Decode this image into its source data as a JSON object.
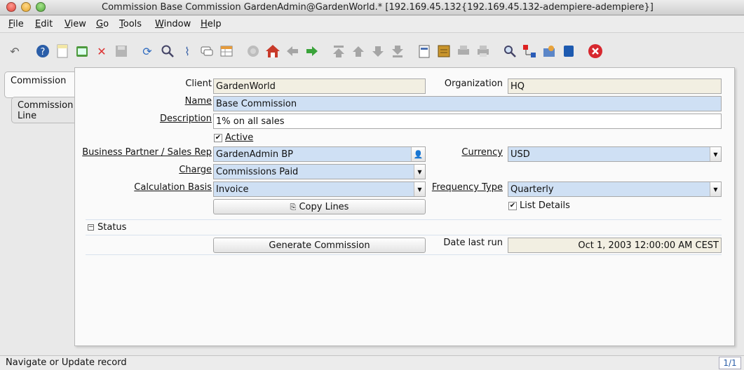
{
  "window": {
    "title": "Commission  Base Commission  GardenAdmin@GardenWorld.* [192.169.45.132{192.169.45.132-adempiere-adempiere}]"
  },
  "menu": [
    {
      "label": "File",
      "mnemonic": "F",
      "rest": "ile"
    },
    {
      "label": "Edit",
      "mnemonic": "E",
      "rest": "dit"
    },
    {
      "label": "View",
      "mnemonic": "V",
      "rest": "iew"
    },
    {
      "label": "Go",
      "mnemonic": "G",
      "rest": "o"
    },
    {
      "label": "Tools",
      "mnemonic": "T",
      "rest": "ools"
    },
    {
      "label": "Window",
      "mnemonic": "W",
      "rest": "indow"
    },
    {
      "label": "Help",
      "mnemonic": "H",
      "rest": "elp"
    }
  ],
  "toolbar": {
    "icons": [
      "undo-icon",
      "help-icon",
      "new-record-icon",
      "copy-record-icon",
      "delete-icon",
      "save-icon",
      "refresh-icon",
      "find-icon",
      "attachment-icon",
      "chat-icon",
      "grid-toggle-icon",
      "history-icon",
      "home-icon",
      "back-icon",
      "forward-icon",
      "first-record-icon",
      "previous-record-icon",
      "next-record-icon",
      "last-record-icon",
      "report-icon",
      "archive-icon",
      "print-preview-icon",
      "print-icon",
      "zoom-across-icon",
      "workflow-icon",
      "process-icon",
      "product-info-icon",
      "exit-icon"
    ]
  },
  "tabs": [
    {
      "label": "Commission"
    },
    {
      "label": "Commission Line"
    }
  ],
  "form": {
    "client_label": "Client",
    "client_value": "GardenWorld",
    "org_label": "Organization",
    "org_value": "HQ",
    "name_label": "Name",
    "name_value": "Base Commission",
    "description_label": "Description",
    "description_value": "1% on all sales",
    "active_label": "Active",
    "active_checked": true,
    "bpartner_label": "Business Partner / Sales Rep",
    "bpartner_value": "GardenAdmin BP",
    "currency_label": "Currency",
    "currency_value": "USD",
    "charge_label": "Charge",
    "charge_value": "Commissions Paid",
    "calc_basis_label": "Calculation Basis",
    "calc_basis_value": "Invoice",
    "frequency_label": "Frequency Type",
    "frequency_value": "Quarterly",
    "copy_lines_label": "Copy Lines",
    "list_details_label": "List Details",
    "list_details_checked": true,
    "status_section_label": "Status",
    "generate_label": "Generate Commission",
    "date_last_run_label": "Date last run",
    "date_last_run_value": "Oct 1, 2003 12:00:00 AM CEST"
  },
  "statusbar": {
    "message": "Navigate or Update record",
    "record_count": "1/1"
  },
  "colors": {
    "readonly_bg": "#f2efe2",
    "mandatory_bg": "#cfe0f4",
    "exit_red": "#d7282f",
    "home_red": "#c83a2a",
    "arrow_green": "#3aa33a"
  }
}
